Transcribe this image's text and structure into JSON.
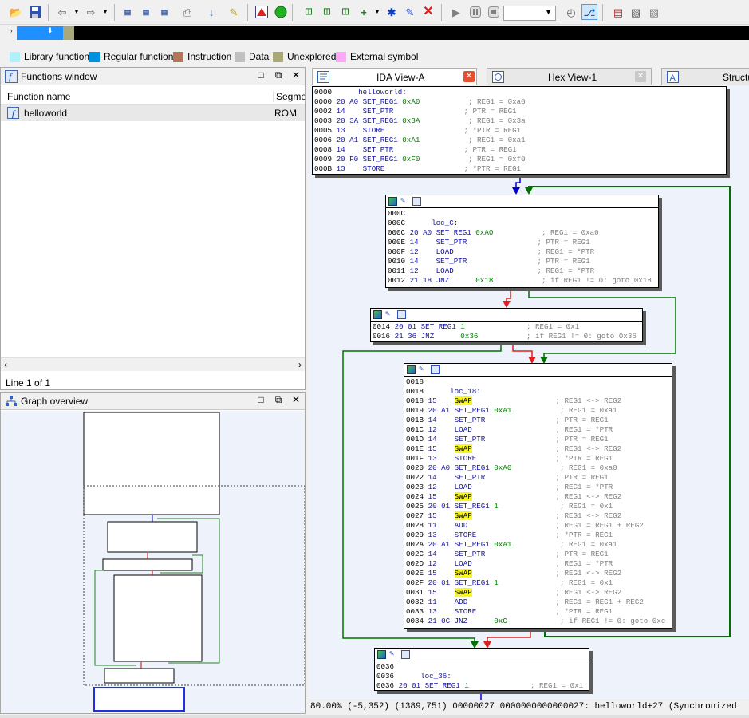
{
  "legend": [
    {
      "label": "Library function",
      "color": "#b0f0f8"
    },
    {
      "label": "Regular function",
      "color": "#0090e0"
    },
    {
      "label": "Instruction",
      "color": "#b07858"
    },
    {
      "label": "Data",
      "color": "#c0c0c0"
    },
    {
      "label": "Unexplored",
      "color": "#a8a878"
    },
    {
      "label": "External symbol",
      "color": "#ffa8f8"
    }
  ],
  "functions_window": {
    "title": "Functions window",
    "col_name": "Function name",
    "col_segment": "Segmen",
    "rows": [
      {
        "name": "helloworld",
        "segment": "ROM"
      }
    ],
    "line_info": "Line 1 of 1"
  },
  "graph_overview": {
    "title": "Graph overview"
  },
  "tabs": [
    {
      "label": "IDA View-A"
    },
    {
      "label": "Hex View-1"
    },
    {
      "label": "Structu"
    }
  ],
  "nodes": [
    {
      "lines": [
        [
          [
            "addr",
            "0000      "
          ],
          [
            "lb",
            "helloworld:"
          ]
        ],
        [
          [
            "addr",
            "0000 "
          ],
          [
            "hex",
            "20 A0 "
          ],
          [
            "mn",
            "SET_REG1 "
          ],
          [
            "op",
            "0xA0"
          ],
          [
            "cm",
            "           ; REG1 = 0xa0"
          ]
        ],
        [
          [
            "addr",
            "0002 "
          ],
          [
            "hex",
            "14    "
          ],
          [
            "mn",
            "SET_PTR"
          ],
          [
            "cm",
            "                ; PTR = REG1"
          ]
        ],
        [
          [
            "addr",
            "0003 "
          ],
          [
            "hex",
            "20 3A "
          ],
          [
            "mn",
            "SET_REG1 "
          ],
          [
            "op",
            "0x3A"
          ],
          [
            "cm",
            "           ; REG1 = 0x3a"
          ]
        ],
        [
          [
            "addr",
            "0005 "
          ],
          [
            "hex",
            "13    "
          ],
          [
            "mn",
            "STORE"
          ],
          [
            "cm",
            "                  ; *PTR = REG1"
          ]
        ],
        [
          [
            "addr",
            "0006 "
          ],
          [
            "hex",
            "20 A1 "
          ],
          [
            "mn",
            "SET_REG1 "
          ],
          [
            "op",
            "0xA1"
          ],
          [
            "cm",
            "           ; REG1 = 0xa1"
          ]
        ],
        [
          [
            "addr",
            "0008 "
          ],
          [
            "hex",
            "14    "
          ],
          [
            "mn",
            "SET_PTR"
          ],
          [
            "cm",
            "                ; PTR = REG1"
          ]
        ],
        [
          [
            "addr",
            "0009 "
          ],
          [
            "hex",
            "20 F0 "
          ],
          [
            "mn",
            "SET_REG1 "
          ],
          [
            "op",
            "0xF0"
          ],
          [
            "cm",
            "           ; REG1 = 0xf0"
          ]
        ],
        [
          [
            "addr",
            "000B "
          ],
          [
            "hex",
            "13    "
          ],
          [
            "mn",
            "STORE"
          ],
          [
            "cm",
            "                  ; *PTR = REG1"
          ]
        ]
      ]
    },
    {
      "lines": [
        [
          [
            "addr",
            "000C"
          ]
        ],
        [
          [
            "addr",
            "000C      "
          ],
          [
            "lb",
            "loc_C:"
          ]
        ],
        [
          [
            "addr",
            "000C "
          ],
          [
            "hex",
            "20 A0 "
          ],
          [
            "mn",
            "SET_REG1 "
          ],
          [
            "op",
            "0xA0"
          ],
          [
            "cm",
            "           ; REG1 = 0xa0"
          ]
        ],
        [
          [
            "addr",
            "000E "
          ],
          [
            "hex",
            "14    "
          ],
          [
            "mn",
            "SET_PTR"
          ],
          [
            "cm",
            "                ; PTR = REG1"
          ]
        ],
        [
          [
            "addr",
            "000F "
          ],
          [
            "hex",
            "12    "
          ],
          [
            "mn",
            "LOAD"
          ],
          [
            "cm",
            "                   ; REG1 = *PTR"
          ]
        ],
        [
          [
            "addr",
            "0010 "
          ],
          [
            "hex",
            "14    "
          ],
          [
            "mn",
            "SET_PTR"
          ],
          [
            "cm",
            "                ; PTR = REG1"
          ]
        ],
        [
          [
            "addr",
            "0011 "
          ],
          [
            "hex",
            "12    "
          ],
          [
            "mn",
            "LOAD"
          ],
          [
            "cm",
            "                   ; REG1 = *PTR"
          ]
        ],
        [
          [
            "addr",
            "0012 "
          ],
          [
            "hex",
            "21 18 "
          ],
          [
            "mn",
            "JNZ      "
          ],
          [
            "op",
            "0x18"
          ],
          [
            "cm",
            "           ; if REG1 != 0: goto 0x18"
          ]
        ]
      ]
    },
    {
      "lines": [
        [
          [
            "addr",
            "0014 "
          ],
          [
            "hex",
            "20 01 "
          ],
          [
            "mn",
            "SET_REG1 "
          ],
          [
            "op",
            "1"
          ],
          [
            "cm",
            "              ; REG1 = 0x1"
          ]
        ],
        [
          [
            "addr",
            "0016 "
          ],
          [
            "hex",
            "21 36 "
          ],
          [
            "mn",
            "JNZ      "
          ],
          [
            "op",
            "0x36"
          ],
          [
            "cm",
            "           ; if REG1 != 0: goto 0x36"
          ]
        ]
      ]
    },
    {
      "lines": [
        [
          [
            "addr",
            "0018"
          ]
        ],
        [
          [
            "addr",
            "0018      "
          ],
          [
            "lb",
            "loc_18:"
          ]
        ],
        [
          [
            "addr",
            "0018 "
          ],
          [
            "hex",
            "15    "
          ],
          [
            "hl",
            "SWAP"
          ],
          [
            "cm",
            "                   ; REG1 <-> REG2"
          ]
        ],
        [
          [
            "addr",
            "0019 "
          ],
          [
            "hex",
            "20 A1 "
          ],
          [
            "mn",
            "SET_REG1 "
          ],
          [
            "op",
            "0xA1"
          ],
          [
            "cm",
            "           ; REG1 = 0xa1"
          ]
        ],
        [
          [
            "addr",
            "001B "
          ],
          [
            "hex",
            "14    "
          ],
          [
            "mn",
            "SET_PTR"
          ],
          [
            "cm",
            "                ; PTR = REG1"
          ]
        ],
        [
          [
            "addr",
            "001C "
          ],
          [
            "hex",
            "12    "
          ],
          [
            "mn",
            "LOAD"
          ],
          [
            "cm",
            "                   ; REG1 = *PTR"
          ]
        ],
        [
          [
            "addr",
            "001D "
          ],
          [
            "hex",
            "14    "
          ],
          [
            "mn",
            "SET_PTR"
          ],
          [
            "cm",
            "                ; PTR = REG1"
          ]
        ],
        [
          [
            "addr",
            "001E "
          ],
          [
            "hex",
            "15    "
          ],
          [
            "hl",
            "SWAP"
          ],
          [
            "cm",
            "                   ; REG1 <-> REG2"
          ]
        ],
        [
          [
            "addr",
            "001F "
          ],
          [
            "hex",
            "13    "
          ],
          [
            "mn",
            "STORE"
          ],
          [
            "cm",
            "                  ; *PTR = REG1"
          ]
        ],
        [
          [
            "addr",
            "0020 "
          ],
          [
            "hex",
            "20 A0 "
          ],
          [
            "mn",
            "SET_REG1 "
          ],
          [
            "op",
            "0xA0"
          ],
          [
            "cm",
            "           ; REG1 = 0xa0"
          ]
        ],
        [
          [
            "addr",
            "0022 "
          ],
          [
            "hex",
            "14    "
          ],
          [
            "mn",
            "SET_PTR"
          ],
          [
            "cm",
            "                ; PTR = REG1"
          ]
        ],
        [
          [
            "addr",
            "0023 "
          ],
          [
            "hex",
            "12    "
          ],
          [
            "mn",
            "LOAD"
          ],
          [
            "cm",
            "                   ; REG1 = *PTR"
          ]
        ],
        [
          [
            "addr",
            "0024 "
          ],
          [
            "hex",
            "15    "
          ],
          [
            "hl",
            "SWAP"
          ],
          [
            "cm",
            "                   ; REG1 <-> REG2"
          ]
        ],
        [
          [
            "addr",
            "0025 "
          ],
          [
            "hex",
            "20 01 "
          ],
          [
            "mn",
            "SET_REG1 "
          ],
          [
            "op",
            "1"
          ],
          [
            "cm",
            "              ; REG1 = 0x1"
          ]
        ],
        [
          [
            "addr",
            "0027 "
          ],
          [
            "hex",
            "15    "
          ],
          [
            "hl",
            "SWAP"
          ],
          [
            "cm",
            "                   ; REG1 <-> REG2"
          ]
        ],
        [
          [
            "addr",
            "0028 "
          ],
          [
            "hex",
            "11    "
          ],
          [
            "mn",
            "ADD"
          ],
          [
            "cm",
            "                    ; REG1 = REG1 + REG2"
          ]
        ],
        [
          [
            "addr",
            "0029 "
          ],
          [
            "hex",
            "13    "
          ],
          [
            "mn",
            "STORE"
          ],
          [
            "cm",
            "                  ; *PTR = REG1"
          ]
        ],
        [
          [
            "addr",
            "002A "
          ],
          [
            "hex",
            "20 A1 "
          ],
          [
            "mn",
            "SET_REG1 "
          ],
          [
            "op",
            "0xA1"
          ],
          [
            "cm",
            "           ; REG1 = 0xa1"
          ]
        ],
        [
          [
            "addr",
            "002C "
          ],
          [
            "hex",
            "14    "
          ],
          [
            "mn",
            "SET_PTR"
          ],
          [
            "cm",
            "                ; PTR = REG1"
          ]
        ],
        [
          [
            "addr",
            "002D "
          ],
          [
            "hex",
            "12    "
          ],
          [
            "mn",
            "LOAD"
          ],
          [
            "cm",
            "                   ; REG1 = *PTR"
          ]
        ],
        [
          [
            "addr",
            "002E "
          ],
          [
            "hex",
            "15    "
          ],
          [
            "hl",
            "SWAP"
          ],
          [
            "cm",
            "                   ; REG1 <-> REG2"
          ]
        ],
        [
          [
            "addr",
            "002F "
          ],
          [
            "hex",
            "20 01 "
          ],
          [
            "mn",
            "SET_REG1 "
          ],
          [
            "op",
            "1"
          ],
          [
            "cm",
            "              ; REG1 = 0x1"
          ]
        ],
        [
          [
            "addr",
            "0031 "
          ],
          [
            "hex",
            "15    "
          ],
          [
            "hl",
            "SWAP"
          ],
          [
            "cm",
            "                   ; REG1 <-> REG2"
          ]
        ],
        [
          [
            "addr",
            "0032 "
          ],
          [
            "hex",
            "11    "
          ],
          [
            "mn",
            "ADD"
          ],
          [
            "cm",
            "                    ; REG1 = REG1 + REG2"
          ]
        ],
        [
          [
            "addr",
            "0033 "
          ],
          [
            "hex",
            "13    "
          ],
          [
            "mn",
            "STORE"
          ],
          [
            "cm",
            "                  ; *PTR = REG1"
          ]
        ],
        [
          [
            "addr",
            "0034 "
          ],
          [
            "hex",
            "21 0C "
          ],
          [
            "mn",
            "JNZ      "
          ],
          [
            "op",
            "0xC"
          ],
          [
            "cm",
            "            ; if REG1 != 0: goto 0xc"
          ]
        ]
      ]
    },
    {
      "lines": [
        [
          [
            "addr",
            "0036"
          ]
        ],
        [
          [
            "addr",
            "0036      "
          ],
          [
            "lb",
            "loc_36:"
          ]
        ],
        [
          [
            "addr",
            "0036 "
          ],
          [
            "hex",
            "20 01 "
          ],
          [
            "mn",
            "SET_REG1 "
          ],
          [
            "op",
            "1"
          ],
          [
            "cm",
            "              ; REG1 = 0x1"
          ]
        ]
      ]
    }
  ],
  "status_bar": "80.00% (-5,352) (1389,751) 00000027 0000000000000027: helloworld+27 (Synchronized"
}
